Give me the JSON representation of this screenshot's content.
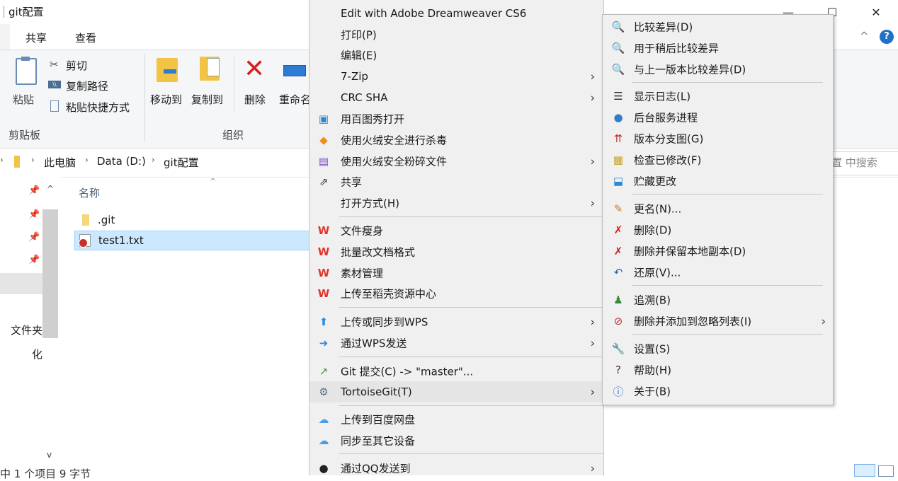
{
  "window": {
    "title": "git配置",
    "minimize": "—",
    "maximize": "☐",
    "close": "✕"
  },
  "ribbon": {
    "tabs": [
      "共享",
      "查看"
    ],
    "help_collapse": "^",
    "help": "?",
    "clipboard": {
      "paste": "粘贴",
      "cut": "剪切",
      "copy_path": "复制路径",
      "paste_shortcut": "粘贴快捷方式",
      "group_label": "剪贴板"
    },
    "organize": {
      "move_to": "移动到",
      "copy_to": "复制到",
      "delete": "删除",
      "rename": "重命名",
      "group_label": "组织"
    }
  },
  "address": {
    "crumbs": [
      "此电脑",
      "Data (D:)",
      "git配置"
    ],
    "search_placeholder": "置 中搜索"
  },
  "nav": {
    "partial_items": [
      "文件夹",
      "化"
    ]
  },
  "filelist": {
    "column_name": "名称",
    "files": [
      ".git",
      "test1.txt"
    ]
  },
  "status": {
    "text": "中 1 个项目  9 字节"
  },
  "menu1": {
    "items": [
      {
        "label": "Edit with Adobe Dreamweaver CS6",
        "icon": "none",
        "submenu": false
      },
      {
        "label": "打印(P)",
        "icon": "none",
        "submenu": false
      },
      {
        "label": "编辑(E)",
        "icon": "none",
        "submenu": false
      },
      {
        "label": "7-Zip",
        "icon": "none",
        "submenu": true
      },
      {
        "label": "CRC SHA",
        "icon": "none",
        "submenu": true
      },
      {
        "label": "用百图秀打开",
        "icon": "image-viewer-icon",
        "submenu": false
      },
      {
        "label": "使用火绒安全进行杀毒",
        "icon": "huorong-shield-icon",
        "submenu": false
      },
      {
        "label": "使用火绒安全粉碎文件",
        "icon": "shredder-icon",
        "submenu": true
      },
      {
        "label": "共享",
        "icon": "share-icon",
        "submenu": false
      },
      {
        "label": "打开方式(H)",
        "icon": "none",
        "submenu": true
      },
      {
        "label": "文件瘦身",
        "icon": "wps-icon",
        "submenu": false
      },
      {
        "label": "批量改文档格式",
        "icon": "wps-icon",
        "submenu": false
      },
      {
        "label": "素材管理",
        "icon": "wps-icon",
        "submenu": false
      },
      {
        "label": "上传至稻壳资源中心",
        "icon": "wps-icon",
        "submenu": false
      },
      {
        "label": "上传或同步到WPS",
        "icon": "cloud-upload-icon",
        "submenu": true
      },
      {
        "label": "通过WPS发送",
        "icon": "send-arrow-icon",
        "submenu": true
      },
      {
        "label": "Git 提交(C) -> \"master\"...",
        "icon": "git-commit-icon",
        "submenu": false
      },
      {
        "label": "TortoiseGit(T)",
        "icon": "tortoisegit-icon",
        "submenu": true
      },
      {
        "label": "上传到百度网盘",
        "icon": "baidu-cloud-icon",
        "submenu": false
      },
      {
        "label": "同步至其它设备",
        "icon": "baidu-cloud-icon",
        "submenu": false
      },
      {
        "label": "通过QQ发送到",
        "icon": "qq-icon",
        "submenu": true
      }
    ]
  },
  "menu2": {
    "items": [
      {
        "label": "比较差异(D)",
        "icon": "diff-magnifier-icon",
        "submenu": false
      },
      {
        "label": "用于稍后比较差异",
        "icon": "diff-magnifier-icon",
        "submenu": false
      },
      {
        "label": "与上一版本比较差异(D)",
        "icon": "diff-magnifier-icon",
        "submenu": false
      },
      {
        "label": "显示日志(L)",
        "icon": "log-icon",
        "submenu": false
      },
      {
        "label": "后台服务进程",
        "icon": "globe-icon",
        "submenu": false
      },
      {
        "label": "版本分支图(G)",
        "icon": "revision-graph-icon",
        "submenu": false
      },
      {
        "label": "检查已修改(F)",
        "icon": "check-modified-icon",
        "submenu": false
      },
      {
        "label": "贮藏更改",
        "icon": "stash-icon",
        "submenu": false
      },
      {
        "label": "更名(N)...",
        "icon": "rename-pen-icon",
        "submenu": false
      },
      {
        "label": "删除(D)",
        "icon": "delete-x-icon",
        "submenu": false
      },
      {
        "label": "删除并保留本地副本(D)",
        "icon": "delete-x-icon",
        "submenu": false
      },
      {
        "label": "还原(V)...",
        "icon": "revert-icon",
        "submenu": false
      },
      {
        "label": "追溯(B)",
        "icon": "blame-icon",
        "submenu": false
      },
      {
        "label": "删除并添加到忽略列表(I)",
        "icon": "ignore-icon",
        "submenu": true
      },
      {
        "label": "设置(S)",
        "icon": "wrench-icon",
        "submenu": false
      },
      {
        "label": "帮助(H)",
        "icon": "help-icon",
        "submenu": false
      },
      {
        "label": "关于(B)",
        "icon": "about-icon",
        "submenu": false
      }
    ]
  }
}
